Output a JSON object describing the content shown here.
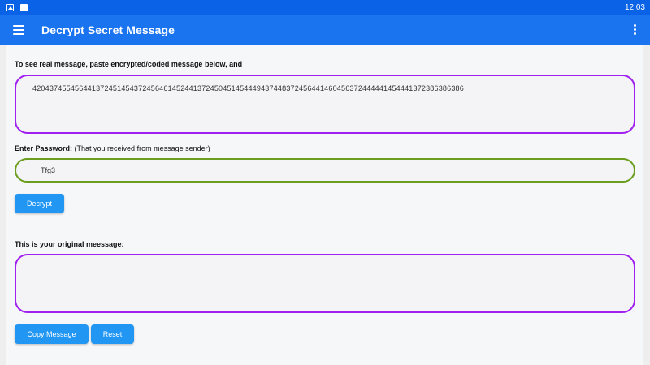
{
  "statusbar": {
    "time": "12:03",
    "icons": [
      "image-icon",
      "a-icon"
    ]
  },
  "appbar": {
    "title": "Decrypt Secret Message",
    "menu_icon": "hamburger-menu-icon",
    "overflow_icon": "more-vert-icon"
  },
  "encrypted": {
    "label": "To see real message, paste encrypted/coded message below, and",
    "value": "42043745545644137245145437245646145244137245045145444943744837245644146045637244444145444137238638638​6"
  },
  "password": {
    "label_bold": "Enter Password:",
    "label_note": " (That you received from message sender)",
    "value": "Tfg3"
  },
  "decrypt_button": {
    "label": "Decrypt"
  },
  "original": {
    "label": "This is your original meessage:",
    "value": ""
  },
  "copy_button": {
    "label": "Copy Message"
  },
  "reset_button": {
    "label": "Reset"
  },
  "colors": {
    "statusbar": "#0a63e6",
    "appbar": "#1a73ef",
    "button": "#2196f3",
    "text_border": "#a020f0",
    "password_border": "#6b9d1f"
  }
}
